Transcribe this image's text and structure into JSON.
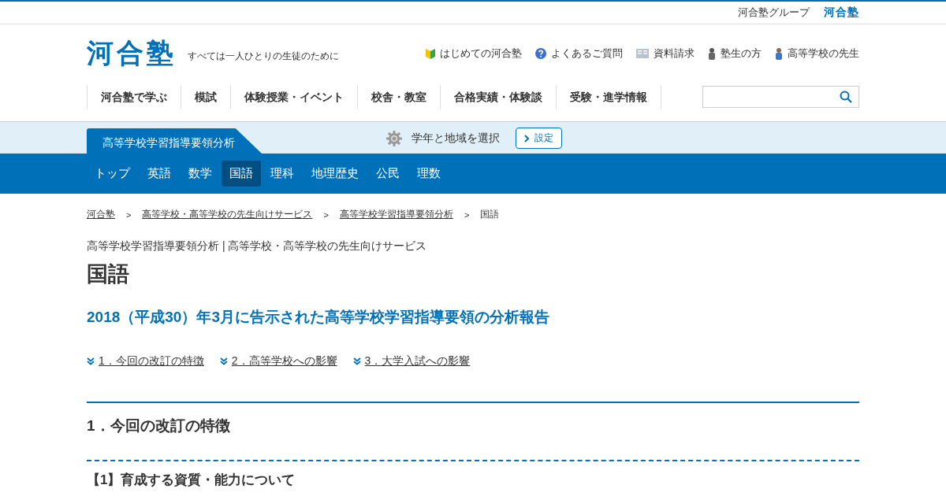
{
  "top_bar": {
    "group_link": "河合塾グループ",
    "group_logo": "河合塾"
  },
  "header": {
    "logo": "河合塾",
    "tagline": "すべては一人ひとりの生徒のために",
    "links": [
      {
        "label": "はじめての河合塾",
        "kind": "beginner"
      },
      {
        "label": "よくあるご質問",
        "kind": "question"
      },
      {
        "label": "資料請求",
        "kind": "document"
      },
      {
        "label": "塾生の方",
        "kind": "student"
      },
      {
        "label": "高等学校の先生",
        "kind": "teacher"
      }
    ]
  },
  "main_nav": [
    "河合塾で学ぶ",
    "模試",
    "体験授業・イベント",
    "校舎・教室",
    "合格実績・体験談",
    "受験・進学情報"
  ],
  "section_band": {
    "tab": "高等学校学習指導要領分析",
    "region_label": "学年と地域を選択",
    "settings_button": "設定"
  },
  "sub_nav": [
    {
      "label": "トップ",
      "selected": false
    },
    {
      "label": "英語",
      "selected": false
    },
    {
      "label": "数学",
      "selected": false
    },
    {
      "label": "国語",
      "selected": true
    },
    {
      "label": "理科",
      "selected": false
    },
    {
      "label": "地理歴史",
      "selected": false
    },
    {
      "label": "公民",
      "selected": false
    },
    {
      "label": "理数",
      "selected": false
    }
  ],
  "breadcrumb": [
    {
      "label": "河合塾",
      "link": true
    },
    {
      "label": "高等学校・高等学校の先生向けサービス",
      "link": true
    },
    {
      "label": "高等学校学習指導要領分析",
      "link": true
    },
    {
      "label": "国語",
      "link": false
    }
  ],
  "breadcrumb_separator": ">",
  "page": {
    "category": "高等学校学習指導要領分析 | 高等学校・高等学校の先生向けサービス",
    "title": "国語",
    "subtitle": "2018（平成30）年3月に告示された高等学校学習指導要領の分析報告",
    "anchors": [
      "1．今回の改訂の特徴",
      "2．高等学校への影響",
      "3．大学入試への影響"
    ],
    "section_heading": "1．今回の改訂の特徴",
    "subsection_heading": "【1】育成する資質・能力について"
  }
}
